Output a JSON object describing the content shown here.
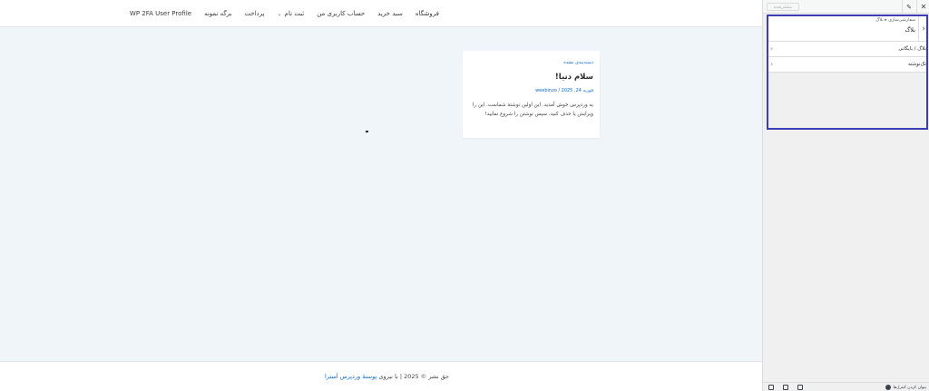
{
  "header": {
    "nav": [
      {
        "label": "WP 2FA User Profile"
      },
      {
        "label": "برگه نمونه"
      },
      {
        "label": "پرداخت"
      },
      {
        "label": "ثبت نام",
        "has_dropdown": true
      },
      {
        "label": "حساب کاربری من"
      },
      {
        "label": "سبد خرید"
      },
      {
        "label": "فروشگاه"
      }
    ]
  },
  "post": {
    "category": "دسته‌بندی نشده",
    "title": "سلام دنیا!",
    "date": "فوریه 24, 2025",
    "separator": " / ",
    "author": "weebinzo",
    "excerpt": "به وردپرس خوش آمدید. این اولین نوشتهٔ شماست. این را ویرایش یا حذف کنید، سپس نوشتن را شروع نمایید!"
  },
  "footer": {
    "copyright_prefix": "حق نشر © 2025 | با نیروی ",
    "theme_link": "پوستهٔ وردپرس آسترا"
  },
  "panel": {
    "publish_label": "منتشرشده",
    "breadcrumb": "سفارشی‌سازی ▸ بلاگ",
    "title": "بلاگ",
    "rows": [
      {
        "label": "بلاگ / بایگانی"
      },
      {
        "label": "تک‌نوشته"
      }
    ],
    "hide_controls_label": "پنهان کردن کنترل‌ها"
  },
  "colors": {
    "accent": "#0b6bcb",
    "highlight": "#3f3db5",
    "preview_bg": "#f0f5fa"
  }
}
